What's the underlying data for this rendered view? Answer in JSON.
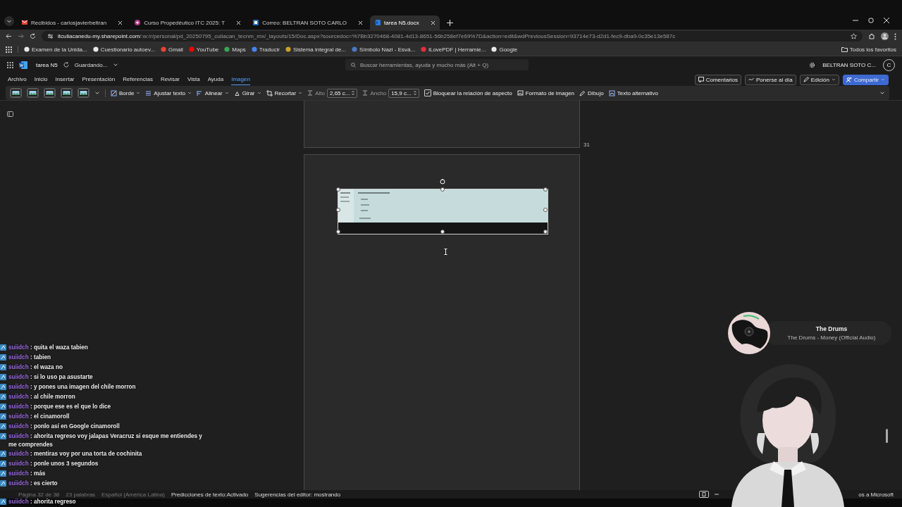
{
  "browser": {
    "tabs": [
      {
        "title": "Recibidos - carlosjavierbeltran",
        "selected": false
      },
      {
        "title": "Curso Propedéutico ITC 2025: T",
        "selected": false
      },
      {
        "title": "Correo: BELTRAN SOTO CARLO",
        "selected": false
      },
      {
        "title": "tarea N5.docx",
        "selected": true
      }
    ],
    "url": {
      "host": "itculiacanedu-my.sharepoint.com",
      "path": "/:w:/r/personal/pd_20250795_culiacan_tecnm_mx/_layouts/15/Doc.aspx?sourcedoc=%7Bb3270468-4081-4d13-8651-56b258ef7e69%7D&action=edit&wdPreviousSession=93714e73-d2d1-fec9-dba9-0c35e13e587c"
    },
    "bookmarks": [
      "Examen de la Unida...",
      "Cuestionario autoev...",
      "Gmail",
      "YouTube",
      "Maps",
      "Traducir",
      "Sistema integral de...",
      "Símbolo Nazi - Esvá...",
      "iLovePDF | Herramie...",
      "Google"
    ],
    "all_bookmarks": "Todos los favoritos"
  },
  "word": {
    "doc_title": "tarea N5",
    "save_status": "Guardando...",
    "search": {
      "placeholder": "Buscar herramientas, ayuda y mucho más (Alt + Q)"
    },
    "account": "BELTRAN SOTO C...",
    "avatar": "C",
    "tabs": [
      {
        "label": "Archivo",
        "selected": false
      },
      {
        "label": "Inicio",
        "selected": false
      },
      {
        "label": "Insertar",
        "selected": false
      },
      {
        "label": "Presentación",
        "selected": false
      },
      {
        "label": "Referencias",
        "selected": false
      },
      {
        "label": "Revisar",
        "selected": false
      },
      {
        "label": "Vista",
        "selected": false
      },
      {
        "label": "Ayuda",
        "selected": false
      },
      {
        "label": "Imagen",
        "selected": true
      }
    ],
    "actions": [
      {
        "label": "Comentarios",
        "primary": false
      },
      {
        "label": "Ponerse al día",
        "primary": false
      },
      {
        "label": "Edición",
        "primary": false
      },
      {
        "label": "Compartir",
        "primary": true
      }
    ],
    "toolbar": [
      {
        "kind": "dropdown",
        "label": "Borde"
      },
      {
        "kind": "dropdown",
        "label": "Ajustar texto"
      },
      {
        "kind": "dropdown",
        "label": "Alinear"
      },
      {
        "kind": "dropdown",
        "label": "Girar"
      },
      {
        "kind": "dropdown",
        "label": "Recortar"
      },
      {
        "kind": "field",
        "label": "Alto",
        "value": "2,65 c..."
      },
      {
        "kind": "field",
        "label": "Ancho",
        "value": "15,9 c..."
      },
      {
        "kind": "checkbox",
        "label": "Bloquear la relación de aspecto",
        "checked": true
      },
      {
        "kind": "button",
        "label": "Formato de imagen"
      },
      {
        "kind": "button",
        "label": "Dibujo"
      },
      {
        "kind": "button",
        "label": "Texto alternativo"
      }
    ],
    "page_number": "31",
    "status": [
      {
        "text": "Página 32 de 38",
        "disabled": true
      },
      {
        "text": "23 palabras",
        "disabled": true
      },
      {
        "text": "Español (América Latina)",
        "disabled": true
      },
      {
        "text": "Predicciones de texto:Activado",
        "disabled": false
      },
      {
        "text": "Sugerencias del editor: mostrando",
        "disabled": false
      }
    ],
    "feedback": "os a Microsoft"
  },
  "chat": [
    {
      "user": "suiidch",
      "text": ": quita el waza tabien"
    },
    {
      "user": "suiidch",
      "text": ": tabien"
    },
    {
      "user": "suiidch",
      "text": ": el waza no"
    },
    {
      "user": "suiidch",
      "text": ": si lo uso pa asustarte"
    },
    {
      "user": "suiidch",
      "text": ": y pones una imagen del chile morron"
    },
    {
      "user": "suiidch",
      "text": ": al chile morron"
    },
    {
      "user": "suiidch",
      "text": ": porque ese es el que lo dice"
    },
    {
      "user": "suiidch",
      "text": ": el cinamoroll"
    },
    {
      "user": "suiidch",
      "text": ": ponlo así en Google cinamoroll"
    },
    {
      "user": "suiidch",
      "text": ": ahorita regreso voy jalapas Veracruz si esque me entiendes y me comprendes"
    },
    {
      "user": "suiidch",
      "text": ": mentiras voy por una torta de cochinita"
    },
    {
      "user": "suiidch",
      "text": ": ponle unos 3 segundos"
    },
    {
      "user": "suiidch",
      "text": ": más"
    },
    {
      "user": "suiidch",
      "text": ": es cierto"
    },
    {
      "user": "suiidch",
      "text": ": ahorita regreso"
    }
  ],
  "now_playing": {
    "artist": "The Drums",
    "track": "The Drums - Money (Official Audio)"
  }
}
